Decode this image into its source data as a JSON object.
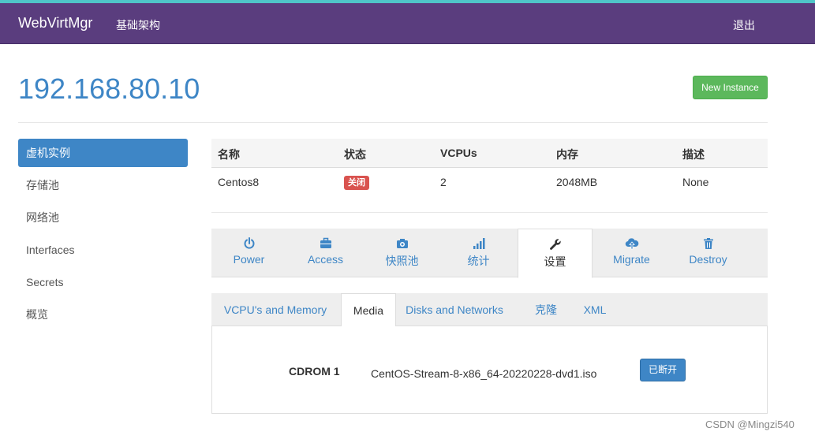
{
  "navbar": {
    "brand": "WebVirtMgr",
    "link": "基础架构",
    "logout": "退出"
  },
  "header": {
    "title": "192.168.80.10",
    "new_instance": "New Instance"
  },
  "sidebar": {
    "items": [
      {
        "label": "虚机实例",
        "active": true
      },
      {
        "label": "存储池"
      },
      {
        "label": "网络池"
      },
      {
        "label": "Interfaces"
      },
      {
        "label": "Secrets"
      },
      {
        "label": "概览"
      }
    ]
  },
  "table": {
    "headers": [
      "名称",
      "状态",
      "VCPUs",
      "内存",
      "描述"
    ],
    "row": {
      "name": "Centos8",
      "status": "关闭",
      "vcpus": "2",
      "memory": "2048MB",
      "desc": "None"
    }
  },
  "action_tabs": [
    {
      "label": "Power",
      "icon": "power-icon"
    },
    {
      "label": "Access",
      "icon": "briefcase-icon"
    },
    {
      "label": "快照池",
      "icon": "camera-icon"
    },
    {
      "label": "统计",
      "icon": "signal-icon"
    },
    {
      "label": "设置",
      "icon": "wrench-icon",
      "active": true
    },
    {
      "label": "Migrate",
      "icon": "cloud-upload-icon"
    },
    {
      "label": "Destroy",
      "icon": "trash-icon"
    }
  ],
  "settings_tabs": [
    {
      "label": "VCPU's and Memory"
    },
    {
      "label": "Media",
      "active": true
    },
    {
      "label": "Disks and Networks"
    },
    {
      "label": "克隆"
    },
    {
      "label": "XML"
    }
  ],
  "media": {
    "label": "CDROM 1",
    "value": "CentOS-Stream-8-x86_64-20220228-dvd1.iso",
    "button": "已断开"
  },
  "watermark": "CSDN @Mingzi540",
  "colors": {
    "navbar": "#5a3d7e",
    "accent": "#3e86c6",
    "success": "#5cb85c",
    "danger": "#d9534f"
  }
}
